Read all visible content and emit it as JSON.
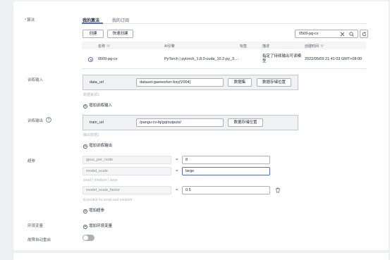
{
  "section": {
    "algorithm_label": "算法"
  },
  "tabs": [
    {
      "label": "我的算法"
    },
    {
      "label": "我的订阅"
    }
  ],
  "toolbar": {
    "create_label": "创建",
    "quick_create_label": "快速创建",
    "search_value": "0509-pg-cv"
  },
  "table": {
    "headers": [
      "名称",
      "AI引擎",
      "标签",
      "描述",
      "创建时间"
    ],
    "row": {
      "name": "0509-pg-cv",
      "engine": "PyTorch | pytorch_1.8.0-cuda_10.2-py_3....",
      "tag": "",
      "description": "指定了持续输出可读模型",
      "created": "2022/05/09 21:41:03 GMT+08:00"
    }
  },
  "train_input": {
    "label": "训练输入",
    "name": "data_url",
    "value": "dataset-gaeworker-bsy(V004)",
    "dataset_button": "数据集",
    "storage_button": "数据存储位置",
    "hint": "数据来源1",
    "add_label": "增加训练输入"
  },
  "train_output": {
    "label": "训练输出",
    "name": "train_url",
    "value": "/pangu-cv-bj/gq/outputs/",
    "storage_button": "数据存储位置",
    "hint": "输出数据1",
    "add_label": "增加训练输出"
  },
  "hyperparams": {
    "label": "超参",
    "items": [
      {
        "name": "gpus_per_node",
        "value": "8",
        "hint": ""
      },
      {
        "name": "model_scale",
        "value": "large",
        "hint": "small | medium | large"
      },
      {
        "name": "model_scale_factor",
        "value": "0.5",
        "hint": "Essential for small and medium"
      }
    ],
    "add_label": "增加超参"
  },
  "env": {
    "label": "环境变量",
    "add_label": "增加环境变量"
  },
  "auto_restart": {
    "label": "故障自动重启",
    "enabled": false
  },
  "colors": {
    "accent": "#526ecc",
    "required": "#e8343a"
  }
}
